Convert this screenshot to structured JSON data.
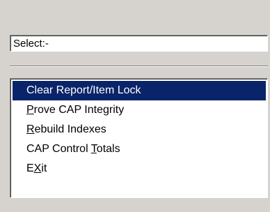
{
  "selector": {
    "value": "Select:-"
  },
  "menu": {
    "items": [
      {
        "label": "Clear Report/Item Lock",
        "accel": "",
        "rest": "Clear Report/Item Lock",
        "selected": true
      },
      {
        "label": "Prove CAP Integrity",
        "accel": "P",
        "rest": "rove CAP Integrity",
        "selected": false
      },
      {
        "label": "Rebuild Indexes",
        "accel": "R",
        "rest": "ebuild Indexes",
        "selected": false
      },
      {
        "label": "CAP Control Totals",
        "pre": "CAP Control ",
        "accel": "T",
        "rest": "otals",
        "selected": false
      },
      {
        "label": "EXit",
        "pre": "E",
        "accel": "X",
        "rest": "it",
        "selected": false
      }
    ]
  },
  "colors": {
    "selection": "#0a246a",
    "face": "#d6d3ce"
  }
}
